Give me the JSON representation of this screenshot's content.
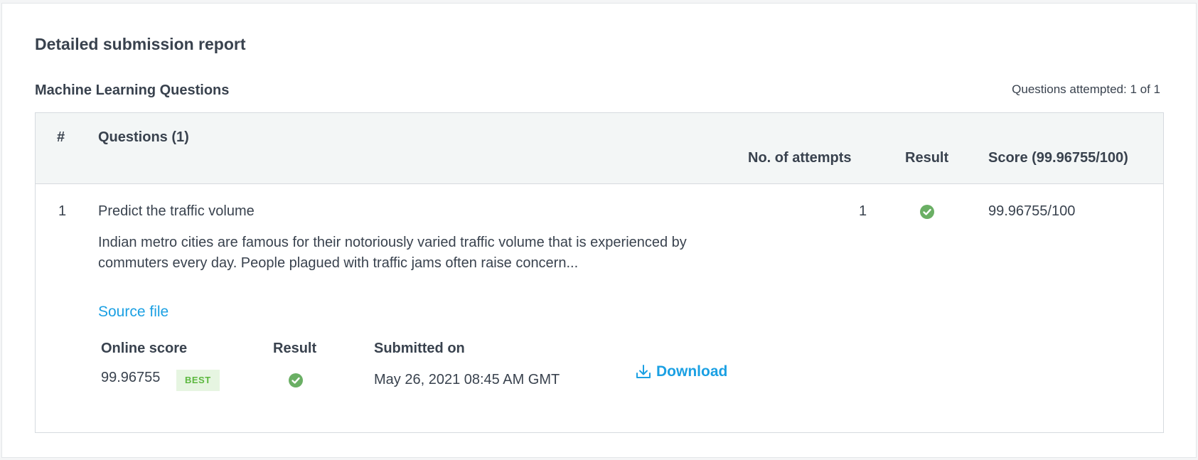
{
  "report": {
    "title": "Detailed submission report",
    "section_title": "Machine Learning Questions",
    "attempted": "Questions attempted: 1 of 1"
  },
  "table": {
    "headers": {
      "number": "#",
      "questions": "Questions (1)",
      "attempts": "No. of attempts",
      "result": "Result",
      "score": "Score (99.96755/100)"
    },
    "rows": [
      {
        "number": "1",
        "title": "Predict the traffic volume",
        "description": "Indian metro cities are famous for their notoriously varied traffic volume that is experienced by commuters every day. People plagued with traffic jams often raise concern...",
        "source_link": "Source file",
        "attempts": "1",
        "result_icon": "check-circle-icon",
        "score": "99.96755/100",
        "submissions": {
          "headers": {
            "online_score": "Online score",
            "result": "Result",
            "submitted_on": "Submitted on"
          },
          "online_score": "99.96755",
          "badge": "BEST",
          "result_icon": "check-circle-icon",
          "submitted_on": "May 26, 2021 08:45 AM GMT",
          "download_label": "Download",
          "download_icon": "download-icon"
        }
      }
    ]
  },
  "colors": {
    "link": "#1ba0e3",
    "success": "#6aaf64",
    "badge_bg": "#e6f5e1",
    "badge_text": "#5cb83f",
    "header_bg": "#f3f6f6",
    "text": "#39424e"
  }
}
